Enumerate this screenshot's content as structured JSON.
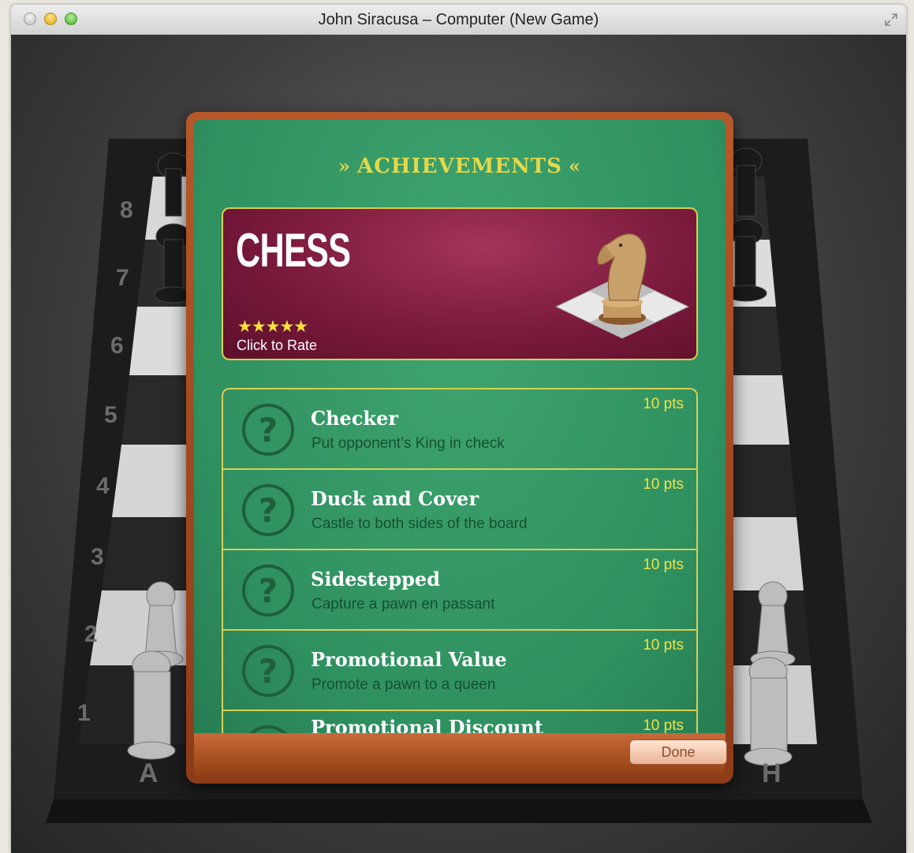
{
  "window": {
    "title": "John Siracusa – Computer   (New Game)"
  },
  "board": {
    "ranks": [
      "8",
      "7",
      "6",
      "5",
      "4",
      "3",
      "2",
      "1"
    ],
    "files": [
      "A",
      "H"
    ]
  },
  "achievements": {
    "header": "ACHIEVEMENTS",
    "header_left_ornament": "»",
    "header_right_ornament": "«",
    "game": {
      "title": "CHESS",
      "stars": "★★★★★",
      "rate_label": "Click to Rate"
    },
    "items": [
      {
        "title": "Checker",
        "description": "Put opponent’s King in check",
        "points": "10 pts"
      },
      {
        "title": "Duck and Cover",
        "description": "Castle to both sides of the board",
        "points": "10 pts"
      },
      {
        "title": "Sidestepped",
        "description": "Capture a pawn en passant",
        "points": "10 pts"
      },
      {
        "title": "Promotional Value",
        "description": "Promote a pawn to a queen",
        "points": "10 pts"
      },
      {
        "title": "Promotional Discount",
        "description": "",
        "points": "10 pts"
      }
    ],
    "done_label": "Done"
  },
  "colors": {
    "felt": "#2f9060",
    "accent_gold": "#e4d84a",
    "card_maroon": "#7b1a3c",
    "wood": "#a8501f"
  }
}
